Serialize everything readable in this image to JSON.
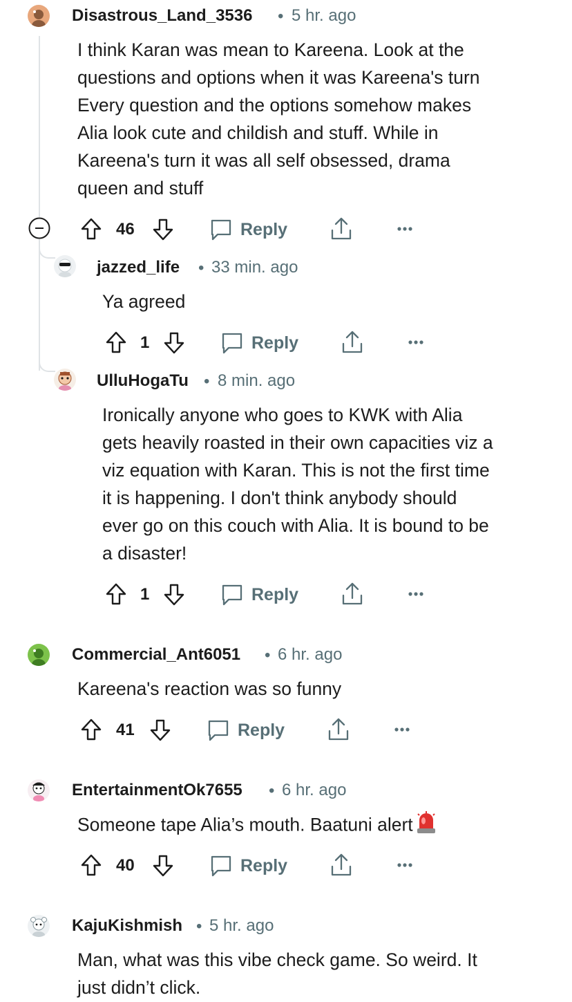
{
  "comments": [
    {
      "author": "Disastrous_Land_3536",
      "time": "5 hr. ago",
      "lines": [
        "I think Karan was mean to Kareena. Look at the",
        "questions and options when it was Kareena's turn",
        "Every question and the options somehow makes",
        "Alia look cute and childish and stuff. While in",
        "Kareena's turn it was all self obsessed, drama",
        "queen and stuff"
      ],
      "votes": "46",
      "reply_label": "Reply",
      "avatar_color": "#e8a77c",
      "collapse_icon": "collapse-minus-icon"
    },
    {
      "author": "jazzed_life",
      "time": "33 min. ago",
      "lines": [
        "Ya agreed"
      ],
      "votes": "1",
      "reply_label": "Reply"
    },
    {
      "author": "UlluHogaTu",
      "time": "8 min. ago",
      "lines": [
        "Ironically anyone who goes to KWK with Alia",
        "gets heavily roasted in their own capacities viz a",
        "viz equation with Karan. This is not the first time",
        "it is happening. I don't think anybody should",
        "ever go on this couch with Alia. It is bound to be",
        "a disaster!"
      ],
      "votes": "1",
      "reply_label": "Reply"
    },
    {
      "author": "Commercial_Ant6051",
      "time": "6 hr. ago",
      "lines": [
        "Kareena's reaction was so funny"
      ],
      "votes": "41",
      "reply_label": "Reply",
      "avatar_color": "#7dc24b"
    },
    {
      "author": "EntertainmentOk7655",
      "time": "6 hr. ago",
      "lines": [
        "Someone tape Alia’s mouth. Baatuni alert"
      ],
      "votes": "40",
      "reply_label": "Reply",
      "emoji": "siren-emoji"
    },
    {
      "author": "KajuKishmish",
      "time": "5 hr. ago",
      "lines": [
        "Man, what was this vibe check game. So weird. It",
        "just didn’t click."
      ]
    }
  ],
  "separator": "•",
  "colors": {
    "meta": "#576f76",
    "text": "#1c1c1c",
    "thread": "#dfe3e6"
  }
}
